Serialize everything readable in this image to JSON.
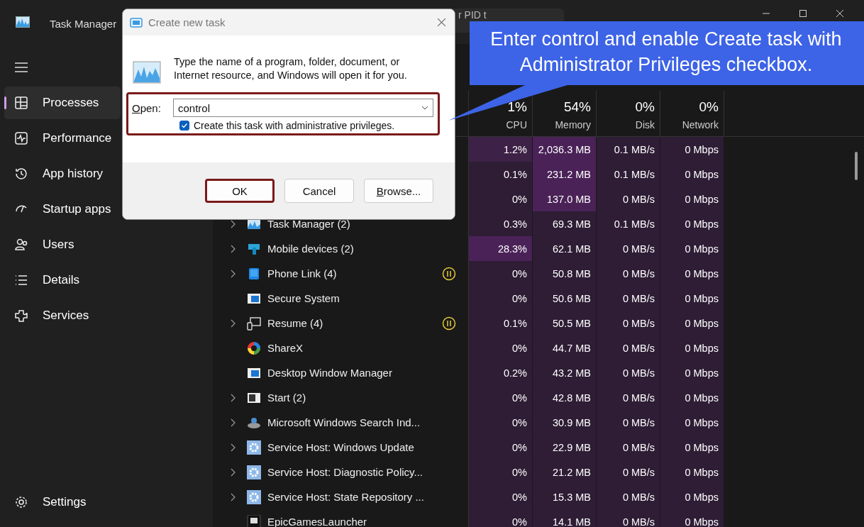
{
  "window": {
    "title": "Task Manager"
  },
  "search": {
    "placeholder": "r PID t"
  },
  "sidebar": {
    "items": [
      {
        "label": "Processes",
        "selected": true
      },
      {
        "label": "Performance",
        "selected": false
      },
      {
        "label": "App history",
        "selected": false
      },
      {
        "label": "Startup apps",
        "selected": false
      },
      {
        "label": "Users",
        "selected": false
      },
      {
        "label": "Details",
        "selected": false
      },
      {
        "label": "Services",
        "selected": false
      }
    ],
    "settings": {
      "label": "Settings"
    }
  },
  "table": {
    "columns": [
      {
        "percent": "1%",
        "label": "CPU"
      },
      {
        "percent": "54%",
        "label": "Memory"
      },
      {
        "percent": "0%",
        "label": "Disk"
      },
      {
        "percent": "0%",
        "label": "Network"
      }
    ],
    "rows": [
      {
        "cells": [
          {
            "text": "1.2%",
            "color": "#3d2146"
          },
          {
            "text": "2,036.3 MB",
            "color": "#4a2257"
          },
          {
            "text": "0.1 MB/s",
            "color": "#2e1d35"
          },
          {
            "text": "0 Mbps",
            "color": "#2e1d35"
          }
        ]
      },
      {
        "cells": [
          {
            "text": "0.1%",
            "color": "#2e1d35"
          },
          {
            "text": "231.2 MB",
            "color": "#4a2257"
          },
          {
            "text": "0.1 MB/s",
            "color": "#2e1d35"
          },
          {
            "text": "0 Mbps",
            "color": "#2e1d35"
          }
        ]
      },
      {
        "cells": [
          {
            "text": "0%",
            "color": "#2e1d35"
          },
          {
            "text": "137.0 MB",
            "color": "#4a2257"
          },
          {
            "text": "0 MB/s",
            "color": "#2e1d35"
          },
          {
            "text": "0 Mbps",
            "color": "#2e1d35"
          }
        ]
      },
      {
        "name": "Task Manager (2)",
        "kind": "taskmgr",
        "expandable": true,
        "paused": false,
        "cells": [
          {
            "text": "0.3%",
            "color": "#2e1d35"
          },
          {
            "text": "69.3 MB",
            "color": "#2e1d35"
          },
          {
            "text": "0.1 MB/s",
            "color": "#2e1d35"
          },
          {
            "text": "0 Mbps",
            "color": "#2e1d35"
          }
        ]
      },
      {
        "name": "Mobile devices (2)",
        "kind": "mobile",
        "expandable": true,
        "paused": false,
        "cells": [
          {
            "text": "28.3%",
            "color": "#4a2257"
          },
          {
            "text": "62.1 MB",
            "color": "#2e1d35"
          },
          {
            "text": "0 MB/s",
            "color": "#2e1d35"
          },
          {
            "text": "0 Mbps",
            "color": "#2e1d35"
          }
        ]
      },
      {
        "name": "Phone Link (4)",
        "kind": "phone",
        "expandable": true,
        "paused": true,
        "cells": [
          {
            "text": "0%",
            "color": "#2e1d35"
          },
          {
            "text": "50.8 MB",
            "color": "#2e1d35"
          },
          {
            "text": "0 MB/s",
            "color": "#2e1d35"
          },
          {
            "text": "0 Mbps",
            "color": "#2e1d35"
          }
        ]
      },
      {
        "name": "Secure System",
        "kind": "window",
        "expandable": false,
        "paused": false,
        "cells": [
          {
            "text": "0%",
            "color": "#2e1d35"
          },
          {
            "text": "50.6 MB",
            "color": "#2e1d35"
          },
          {
            "text": "0 MB/s",
            "color": "#2e1d35"
          },
          {
            "text": "0 Mbps",
            "color": "#2e1d35"
          }
        ]
      },
      {
        "name": "Resume (4)",
        "kind": "resume",
        "expandable": true,
        "paused": true,
        "cells": [
          {
            "text": "0.1%",
            "color": "#2e1d35"
          },
          {
            "text": "50.5 MB",
            "color": "#2e1d35"
          },
          {
            "text": "0 MB/s",
            "color": "#2e1d35"
          },
          {
            "text": "0 Mbps",
            "color": "#2e1d35"
          }
        ]
      },
      {
        "name": "ShareX",
        "kind": "sharex",
        "expandable": false,
        "paused": false,
        "cells": [
          {
            "text": "0%",
            "color": "#2e1d35"
          },
          {
            "text": "44.7 MB",
            "color": "#2e1d35"
          },
          {
            "text": "0 MB/s",
            "color": "#2e1d35"
          },
          {
            "text": "0 Mbps",
            "color": "#2e1d35"
          }
        ]
      },
      {
        "name": "Desktop Window Manager",
        "kind": "window",
        "expandable": false,
        "paused": false,
        "cells": [
          {
            "text": "0.2%",
            "color": "#2e1d35"
          },
          {
            "text": "43.2 MB",
            "color": "#2e1d35"
          },
          {
            "text": "0 MB/s",
            "color": "#2e1d35"
          },
          {
            "text": "0 Mbps",
            "color": "#2e1d35"
          }
        ]
      },
      {
        "name": "Start (2)",
        "kind": "start",
        "expandable": true,
        "paused": false,
        "cells": [
          {
            "text": "0%",
            "color": "#2e1d35"
          },
          {
            "text": "42.8 MB",
            "color": "#2e1d35"
          },
          {
            "text": "0 MB/s",
            "color": "#2e1d35"
          },
          {
            "text": "0 Mbps",
            "color": "#2e1d35"
          }
        ]
      },
      {
        "name": "Microsoft Windows Search Ind...",
        "kind": "indexer",
        "expandable": true,
        "paused": false,
        "cells": [
          {
            "text": "0%",
            "color": "#2e1d35"
          },
          {
            "text": "30.9 MB",
            "color": "#2e1d35"
          },
          {
            "text": "0 MB/s",
            "color": "#2e1d35"
          },
          {
            "text": "0 Mbps",
            "color": "#2e1d35"
          }
        ]
      },
      {
        "name": "Service Host: Windows Update",
        "kind": "service",
        "expandable": true,
        "paused": false,
        "cells": [
          {
            "text": "0%",
            "color": "#2e1d35"
          },
          {
            "text": "22.9 MB",
            "color": "#2e1d35"
          },
          {
            "text": "0 MB/s",
            "color": "#2e1d35"
          },
          {
            "text": "0 Mbps",
            "color": "#2e1d35"
          }
        ]
      },
      {
        "name": "Service Host: Diagnostic Policy...",
        "kind": "service",
        "expandable": true,
        "paused": false,
        "cells": [
          {
            "text": "0%",
            "color": "#2e1d35"
          },
          {
            "text": "21.2 MB",
            "color": "#2e1d35"
          },
          {
            "text": "0 MB/s",
            "color": "#2e1d35"
          },
          {
            "text": "0 Mbps",
            "color": "#2e1d35"
          }
        ]
      },
      {
        "name": "Service Host: State Repository ...",
        "kind": "service",
        "expandable": true,
        "paused": false,
        "cells": [
          {
            "text": "0%",
            "color": "#2e1d35"
          },
          {
            "text": "15.3 MB",
            "color": "#2e1d35"
          },
          {
            "text": "0 MB/s",
            "color": "#2e1d35"
          },
          {
            "text": "0 Mbps",
            "color": "#2e1d35"
          }
        ]
      },
      {
        "name": "EpicGamesLauncher",
        "kind": "epic",
        "expandable": false,
        "paused": false,
        "cells": [
          {
            "text": "0%",
            "color": "#2e1d35"
          },
          {
            "text": "14.1 MB",
            "color": "#2e1d35"
          },
          {
            "text": "0 MB/s",
            "color": "#2e1d35"
          },
          {
            "text": "0 Mbps",
            "color": "#2e1d35"
          }
        ]
      }
    ]
  },
  "dialog": {
    "title": "Create new task",
    "message": "Type the name of a program, folder, document, or Internet resource, and Windows will open it for you.",
    "open_label": "Open:",
    "open_value": "control",
    "open_highlighted": true,
    "admin": {
      "label": "Create this task with administrative privileges.",
      "checked": true
    },
    "buttons": [
      {
        "label": "OK",
        "highlighted": true
      },
      {
        "label": "Cancel",
        "highlighted": false
      },
      {
        "label": "Browse...",
        "highlighted": false
      }
    ]
  },
  "callout": {
    "text": "Enter control and enable Create task with Administrator Privileges checkbox."
  }
}
